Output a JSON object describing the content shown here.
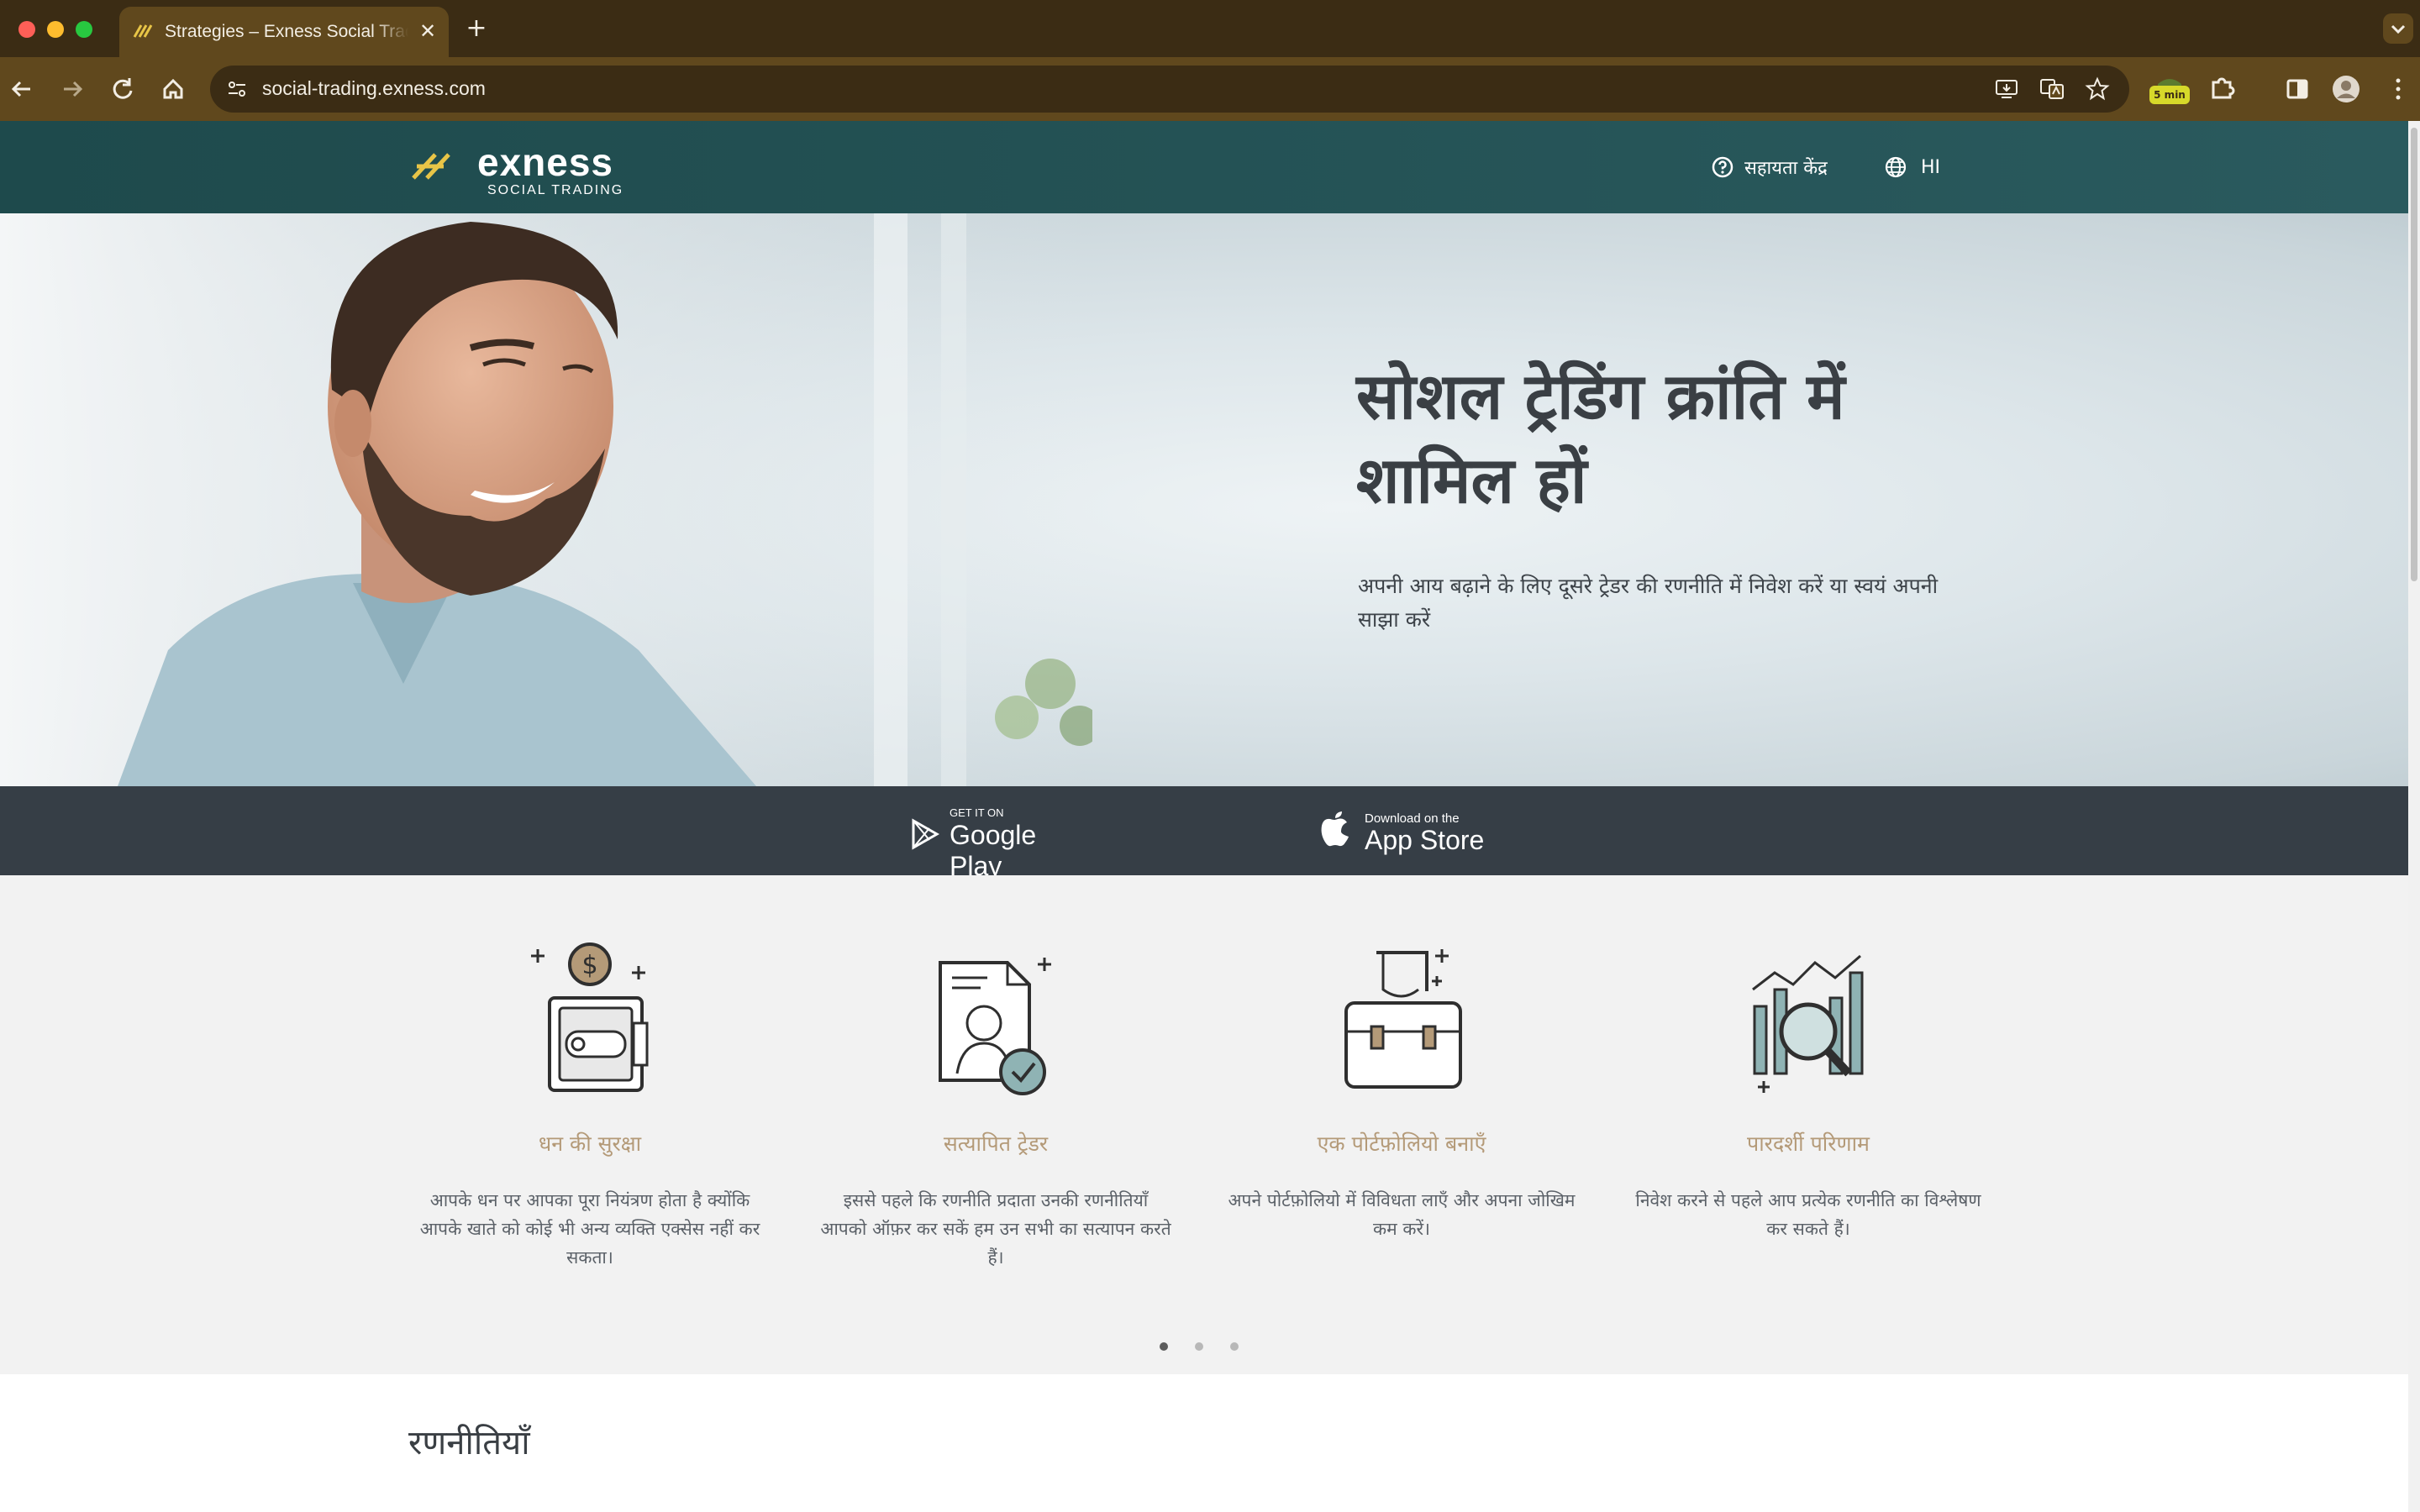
{
  "browser": {
    "tab_title": "Strategies – Exness Social Trading",
    "url": "social-trading.exness.com",
    "extension_badge": "5 min"
  },
  "site_header": {
    "logo_word": "exness",
    "logo_sub": "SOCIAL TRADING",
    "help_label": "सहायता केंद्र",
    "lang_label": "HI"
  },
  "hero": {
    "title": "सोशल ट्रेडिंग क्रांति में शामिल हों",
    "subtitle": "अपनी आय बढ़ाने के लिए दूसरे ट्रेडर की रणनीति में निवेश करें या स्वयं अपनी साझा करें"
  },
  "app_bar": {
    "google_small": "GET IT ON",
    "google_big": "Google Play",
    "apple_small": "Download on the",
    "apple_big": "App Store"
  },
  "features": [
    {
      "title": "धन की सुरक्षा",
      "desc": "आपके धन पर आपका पूरा नियंत्रण होता है क्योंकि आपके खाते को कोई भी अन्य व्यक्ति एक्सेस नहीं कर सकता।",
      "icon": "safe-icon"
    },
    {
      "title": "सत्यापित ट्रेडर",
      "desc": "इससे पहले कि रणनीति प्रदाता उनकी रणनीतियाँ आपको ऑफ़र कर सकें हम उन सभी का सत्यापन करते हैं।",
      "icon": "verified-trader-icon"
    },
    {
      "title": "एक पोर्टफ़ोलियो बनाएँ",
      "desc": "अपने पोर्टफ़ोलियो में विविधता लाएँ और अपना जोखिम कम करें।",
      "icon": "briefcase-icon"
    },
    {
      "title": "पारदर्शी परिणाम",
      "desc": "निवेश करने से पहले आप प्रत्येक रणनीति का विश्लेषण कर सकते हैं।",
      "icon": "chart-magnifier-icon"
    }
  ],
  "carousel": {
    "active_index": 0,
    "count": 3
  },
  "strategies": {
    "title": "रणनीतियाँ"
  },
  "colors": {
    "header": "#1e4a4c",
    "app_bar": "#363e46",
    "feature_title": "#b49a78",
    "logo_accent": "#e8c547"
  }
}
